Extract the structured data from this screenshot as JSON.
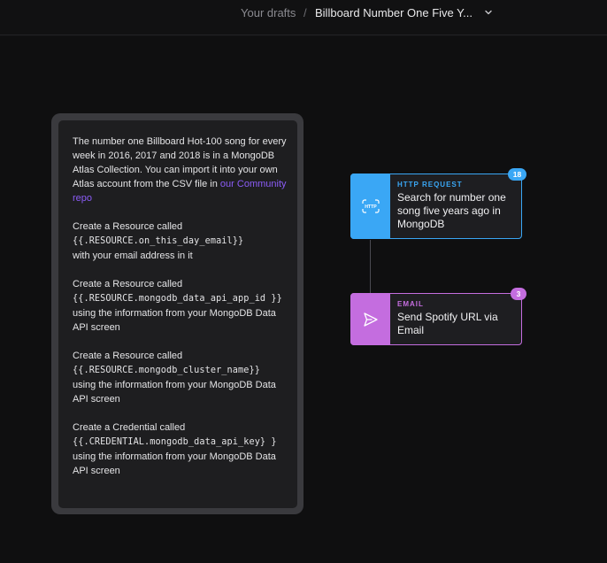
{
  "breadcrumb": {
    "parent": "Your drafts",
    "separator": "/",
    "current": "Billboard Number One Five Y..."
  },
  "note": {
    "p1_text": "The number one Billboard Hot-100 song for every week in 2016, 2017 and 2018 is in a MongoDB Atlas Collection. You can import it into your own Atlas account from the CSV file in ",
    "p1_link": "our Community repo",
    "p2_line1": "Create a Resource called",
    "p2_code": "{{.RESOURCE.on_this_day_email}}",
    "p2_rest": "with your email address in it",
    "p3_line1": "Create a Resource called",
    "p3_code": "{{.RESOURCE.mongodb_data_api_app_id }}",
    "p3_rest": " using the information from your MongoDB Data API screen",
    "p4_line1": "Create a Resource called",
    "p4_code": "{{.RESOURCE.mongodb_cluster_name}}",
    "p4_rest": "using the information from your MongoDB Data API screen",
    "p5_line1": "Create a Credential called",
    "p5_code": "{{.CREDENTIAL.mongodb_data_api_key} }",
    "p5_rest": "using the information from your MongoDB Data API screen"
  },
  "nodes": [
    {
      "type_label": "HTTP REQUEST",
      "title": "Search for number one song five years ago in MongoDB",
      "badge": "18",
      "icon": "http-icon",
      "color": "#3aa7f5"
    },
    {
      "type_label": "EMAIL",
      "title": "Send Spotify URL via Email",
      "badge": "3",
      "icon": "send-icon",
      "color": "#c46ddf"
    }
  ]
}
